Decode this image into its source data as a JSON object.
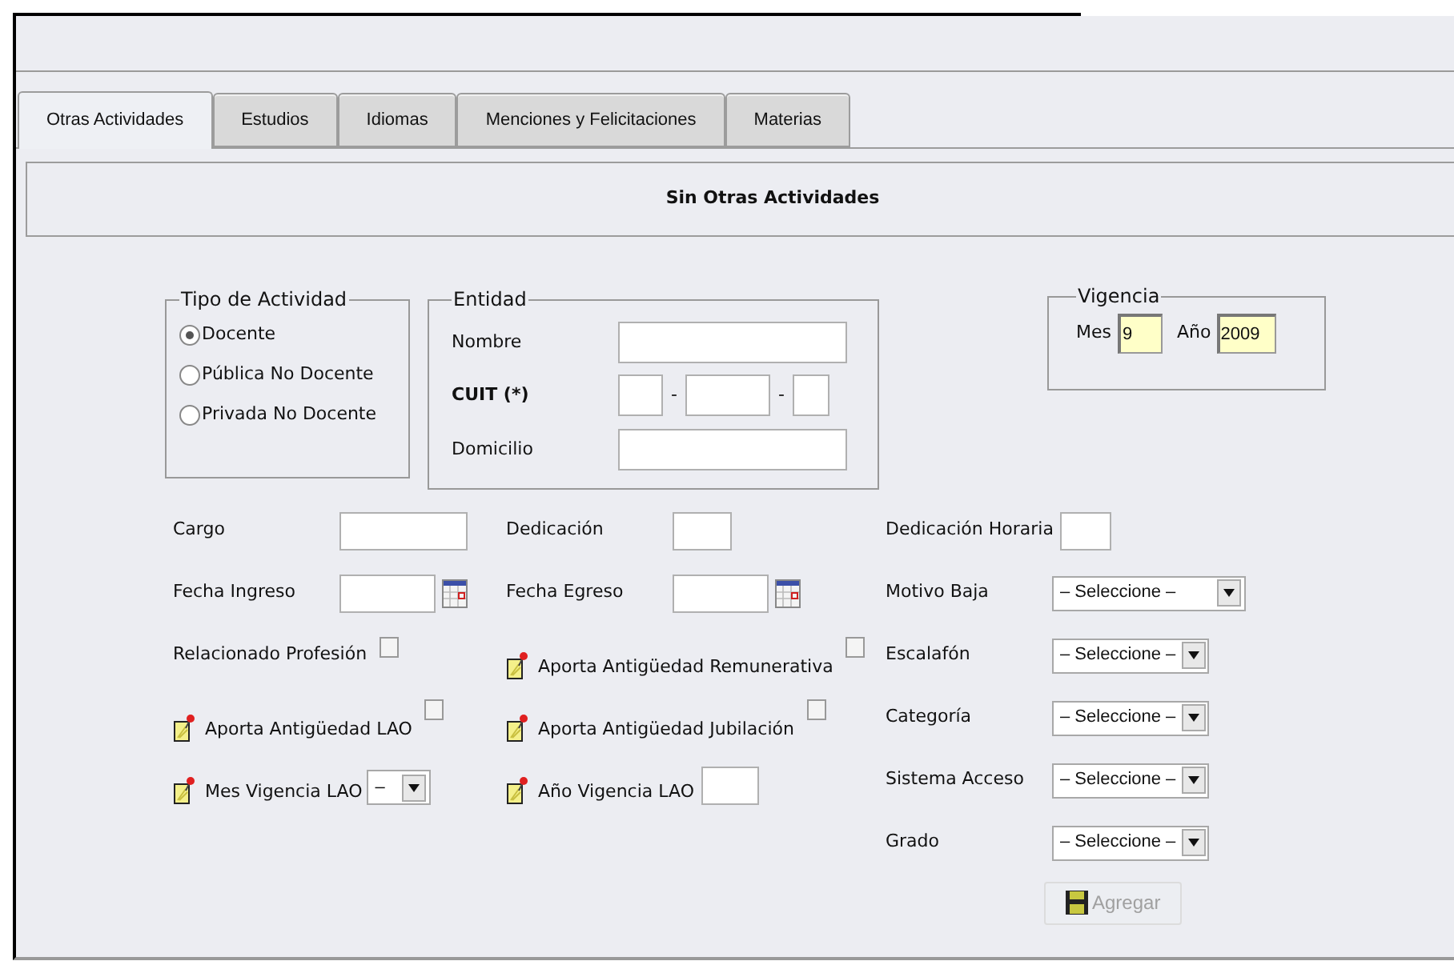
{
  "tabs": [
    {
      "label": "Otras Actividades",
      "selected": true
    },
    {
      "label": "Estudios",
      "selected": false
    },
    {
      "label": "Idiomas",
      "selected": false
    },
    {
      "label": "Menciones y Felicitaciones",
      "selected": false
    },
    {
      "label": "Materias",
      "selected": false
    }
  ],
  "banner": "Sin Otras Actividades",
  "tipo_actividad": {
    "legend": "Tipo de Actividad",
    "options": [
      {
        "label": "Docente",
        "selected": true
      },
      {
        "label": "Pública No Docente",
        "selected": false
      },
      {
        "label": "Privada No Docente",
        "selected": false
      }
    ]
  },
  "entidad": {
    "legend": "Entidad",
    "nombre": {
      "label": "Nombre"
    },
    "cuit": {
      "label": "CUIT (*)",
      "separator": "-"
    },
    "domicilio": {
      "label": "Domicilio"
    }
  },
  "vigencia": {
    "legend": "Vigencia",
    "mes": {
      "label": "Mes",
      "value": "9"
    },
    "anio": {
      "label": "Año",
      "value": "2009"
    }
  },
  "columns": [
    [
      {
        "kind": "text",
        "label": "Cargo",
        "noted": false
      },
      {
        "kind": "date",
        "label": "Fecha Ingreso",
        "noted": false
      },
      {
        "kind": "checkbox",
        "label": "Relacionado Profesión",
        "checked": false,
        "noted": false
      },
      {
        "kind": "checkbox",
        "label": "Aporta Antigüedad LAO",
        "checked": false,
        "noted": true
      },
      {
        "kind": "select",
        "label": "Mes Vigencia LAO",
        "value": "–",
        "noted": true
      }
    ],
    [
      {
        "kind": "text",
        "label": "Dedicación",
        "noted": false
      },
      {
        "kind": "date",
        "label": "Fecha Egreso",
        "noted": false
      },
      {
        "kind": "checkbox",
        "label": "Aporta Antigüedad Remunerativa",
        "checked": false,
        "noted": true
      },
      {
        "kind": "checkbox",
        "label": "Aporta Antigüedad Jubilación",
        "checked": false,
        "noted": true
      },
      {
        "kind": "text",
        "label": "Año Vigencia LAO",
        "noted": true
      }
    ],
    [
      {
        "kind": "text",
        "label": "Dedicación Horaria",
        "noted": false
      },
      {
        "kind": "select",
        "label": "Motivo Baja",
        "value": "– Seleccione –",
        "noted": false
      },
      {
        "kind": "select",
        "label": "Escalafón",
        "value": "– Seleccione –",
        "noted": false
      },
      {
        "kind": "select",
        "label": "Categoría",
        "value": "– Seleccione –",
        "noted": false
      },
      {
        "kind": "select",
        "label": "Sistema Acceso",
        "value": "– Seleccione –",
        "noted": false
      },
      {
        "kind": "select",
        "label": "Grado",
        "value": "– Seleccione –",
        "noted": false
      }
    ]
  ],
  "add_button": {
    "label": "Agregar",
    "disabled": true
  }
}
